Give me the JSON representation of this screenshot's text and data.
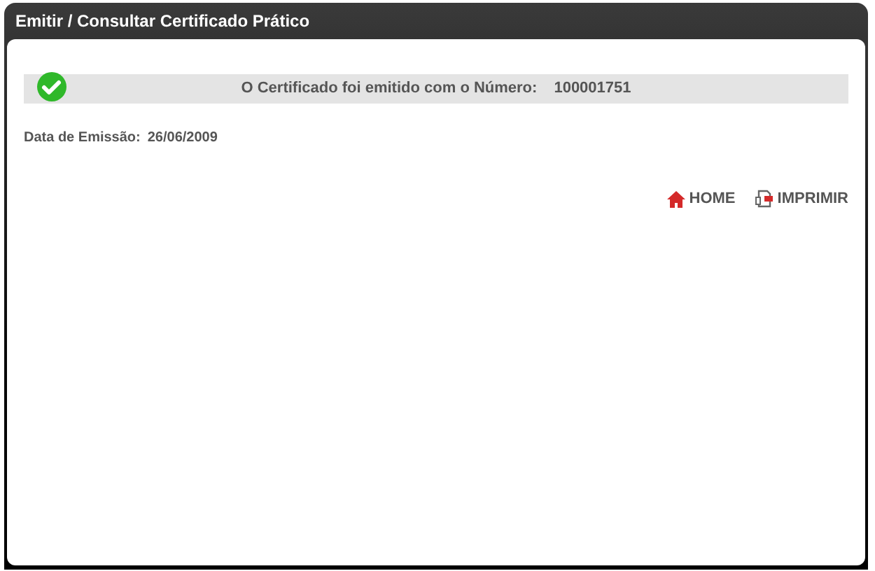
{
  "window": {
    "title": "Emitir / Consultar Certificado Prático"
  },
  "message": {
    "text": "O Certificado foi emitido com o Número:",
    "number": "100001751"
  },
  "issue_date": {
    "label": "Data de Emissão:",
    "value": "26/06/2009"
  },
  "links": [
    {
      "kind": "home",
      "label": "HOME"
    },
    {
      "kind": "print",
      "label": "IMPRIMIR"
    }
  ]
}
